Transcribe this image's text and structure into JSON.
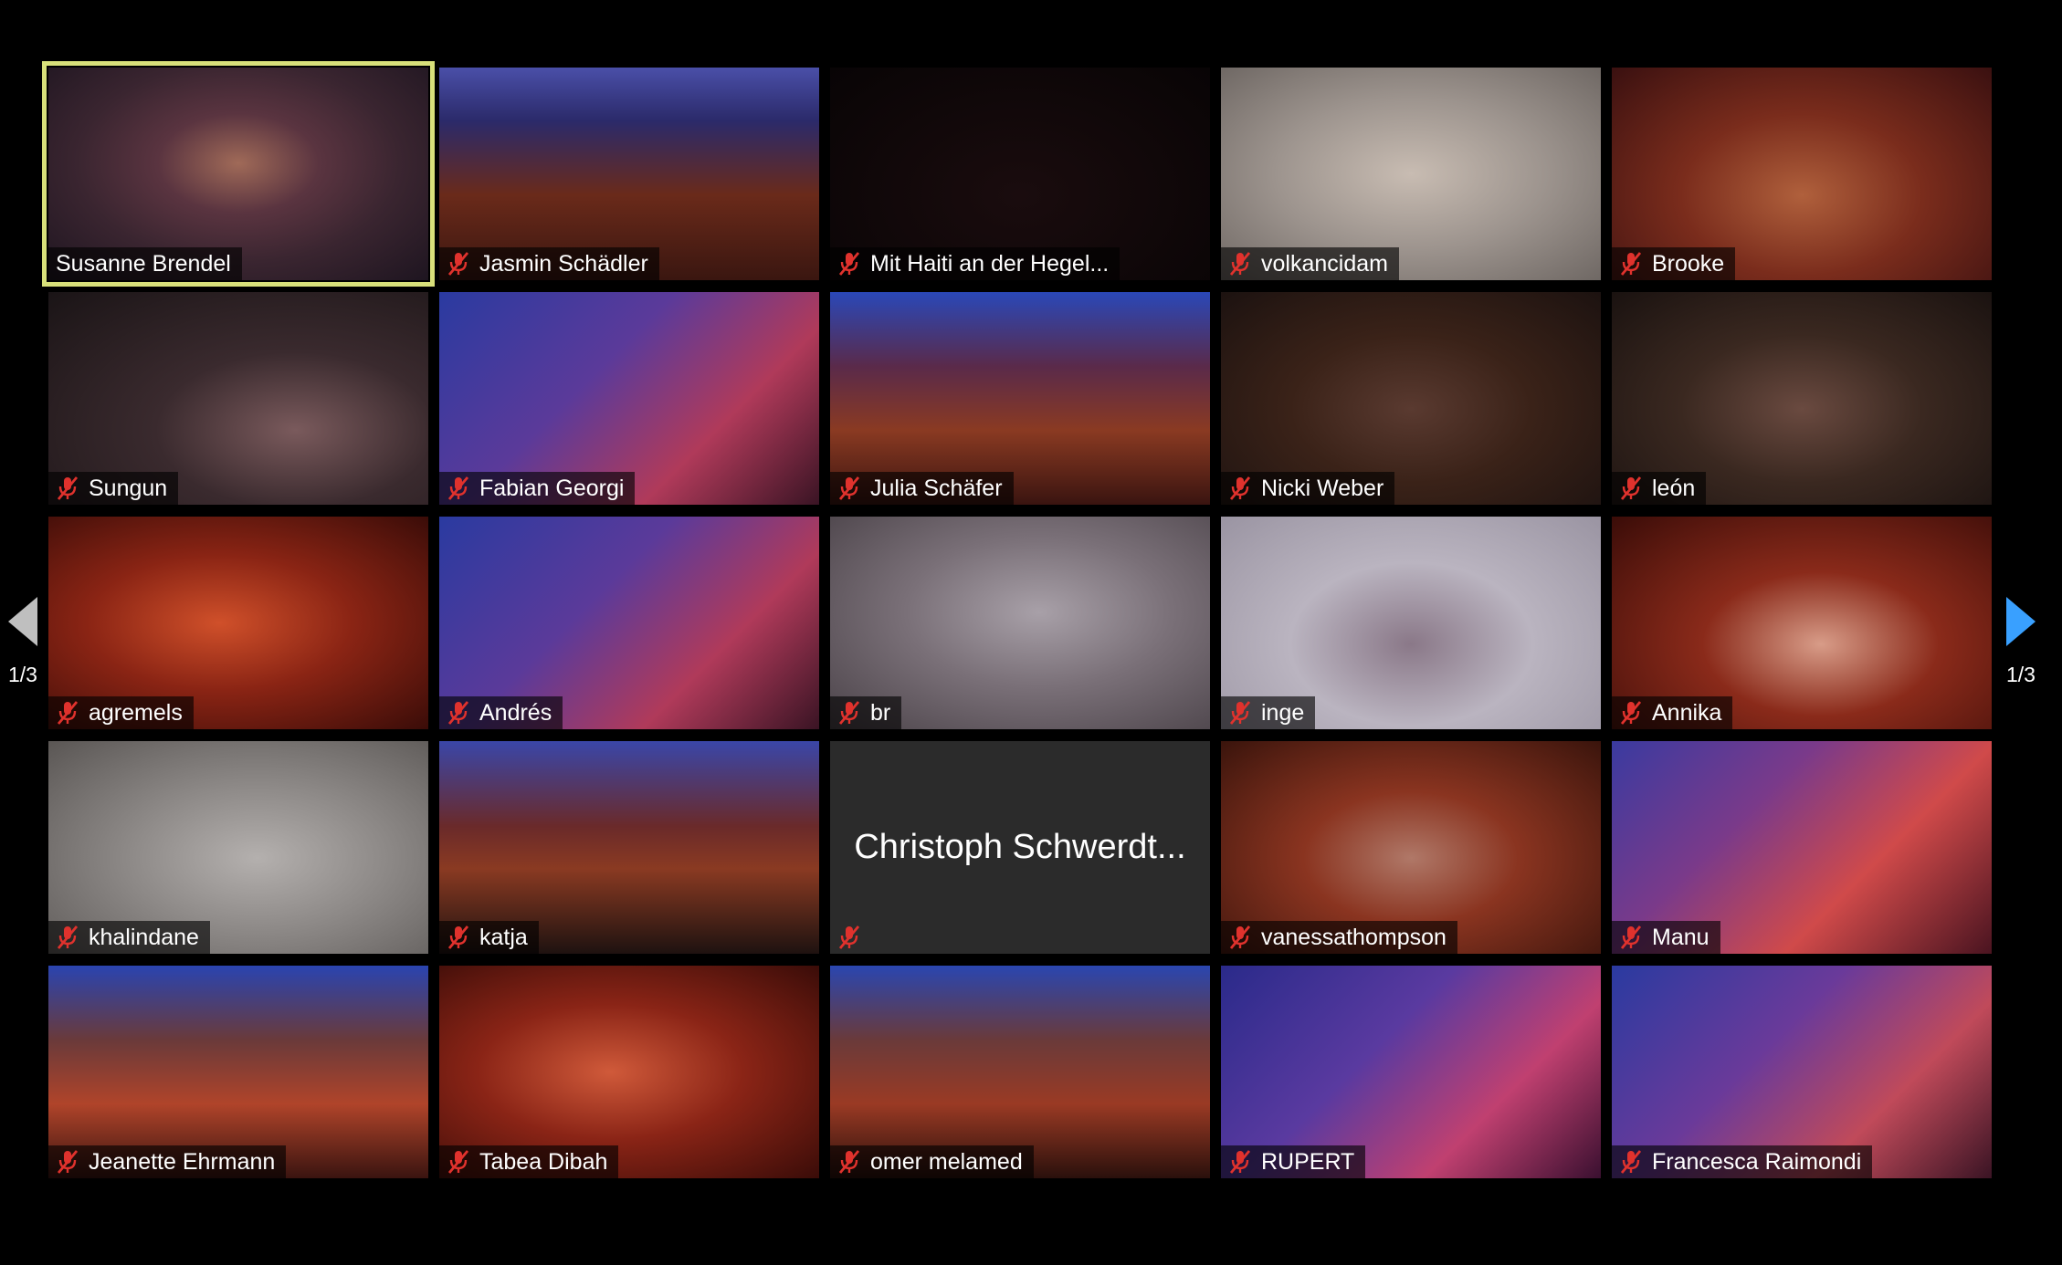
{
  "pager": {
    "left_label": "1/3",
    "right_label": "1/3"
  },
  "colors": {
    "active_speaker_border": "#d8e07a",
    "muted_icon": "#e0322d",
    "next_arrow": "#39a0ff",
    "prev_arrow": "#bfbfbf"
  },
  "participants": [
    {
      "name": "Susanne Brendel",
      "muted": false,
      "speaking": true
    },
    {
      "name": "Jasmin Schädler",
      "muted": true
    },
    {
      "name": "Mit Haiti an der Hegel...",
      "muted": true
    },
    {
      "name": "volkancidam",
      "muted": true
    },
    {
      "name": "Brooke",
      "muted": true
    },
    {
      "name": "Sungun",
      "muted": true
    },
    {
      "name": "Fabian Georgi",
      "muted": true
    },
    {
      "name": "Julia Schäfer",
      "muted": true
    },
    {
      "name": "Nicki Weber",
      "muted": true
    },
    {
      "name": "león",
      "muted": true
    },
    {
      "name": "agremels",
      "muted": true
    },
    {
      "name": "Andrés",
      "muted": true
    },
    {
      "name": "br",
      "muted": true
    },
    {
      "name": "inge",
      "muted": true
    },
    {
      "name": "Annika",
      "muted": true
    },
    {
      "name": "khalindane",
      "muted": true
    },
    {
      "name": "katja",
      "muted": true
    },
    {
      "name": "",
      "display_name": "Christoph Schwerdt...",
      "muted": true,
      "video_off": true
    },
    {
      "name": "vanessathompson",
      "muted": true
    },
    {
      "name": "Manu",
      "muted": true
    },
    {
      "name": "Jeanette Ehrmann",
      "muted": true
    },
    {
      "name": "Tabea Dibah",
      "muted": true
    },
    {
      "name": "omer melamed",
      "muted": true
    },
    {
      "name": "RUPERT",
      "muted": true
    },
    {
      "name": "Francesca Raimondi",
      "muted": true
    }
  ]
}
